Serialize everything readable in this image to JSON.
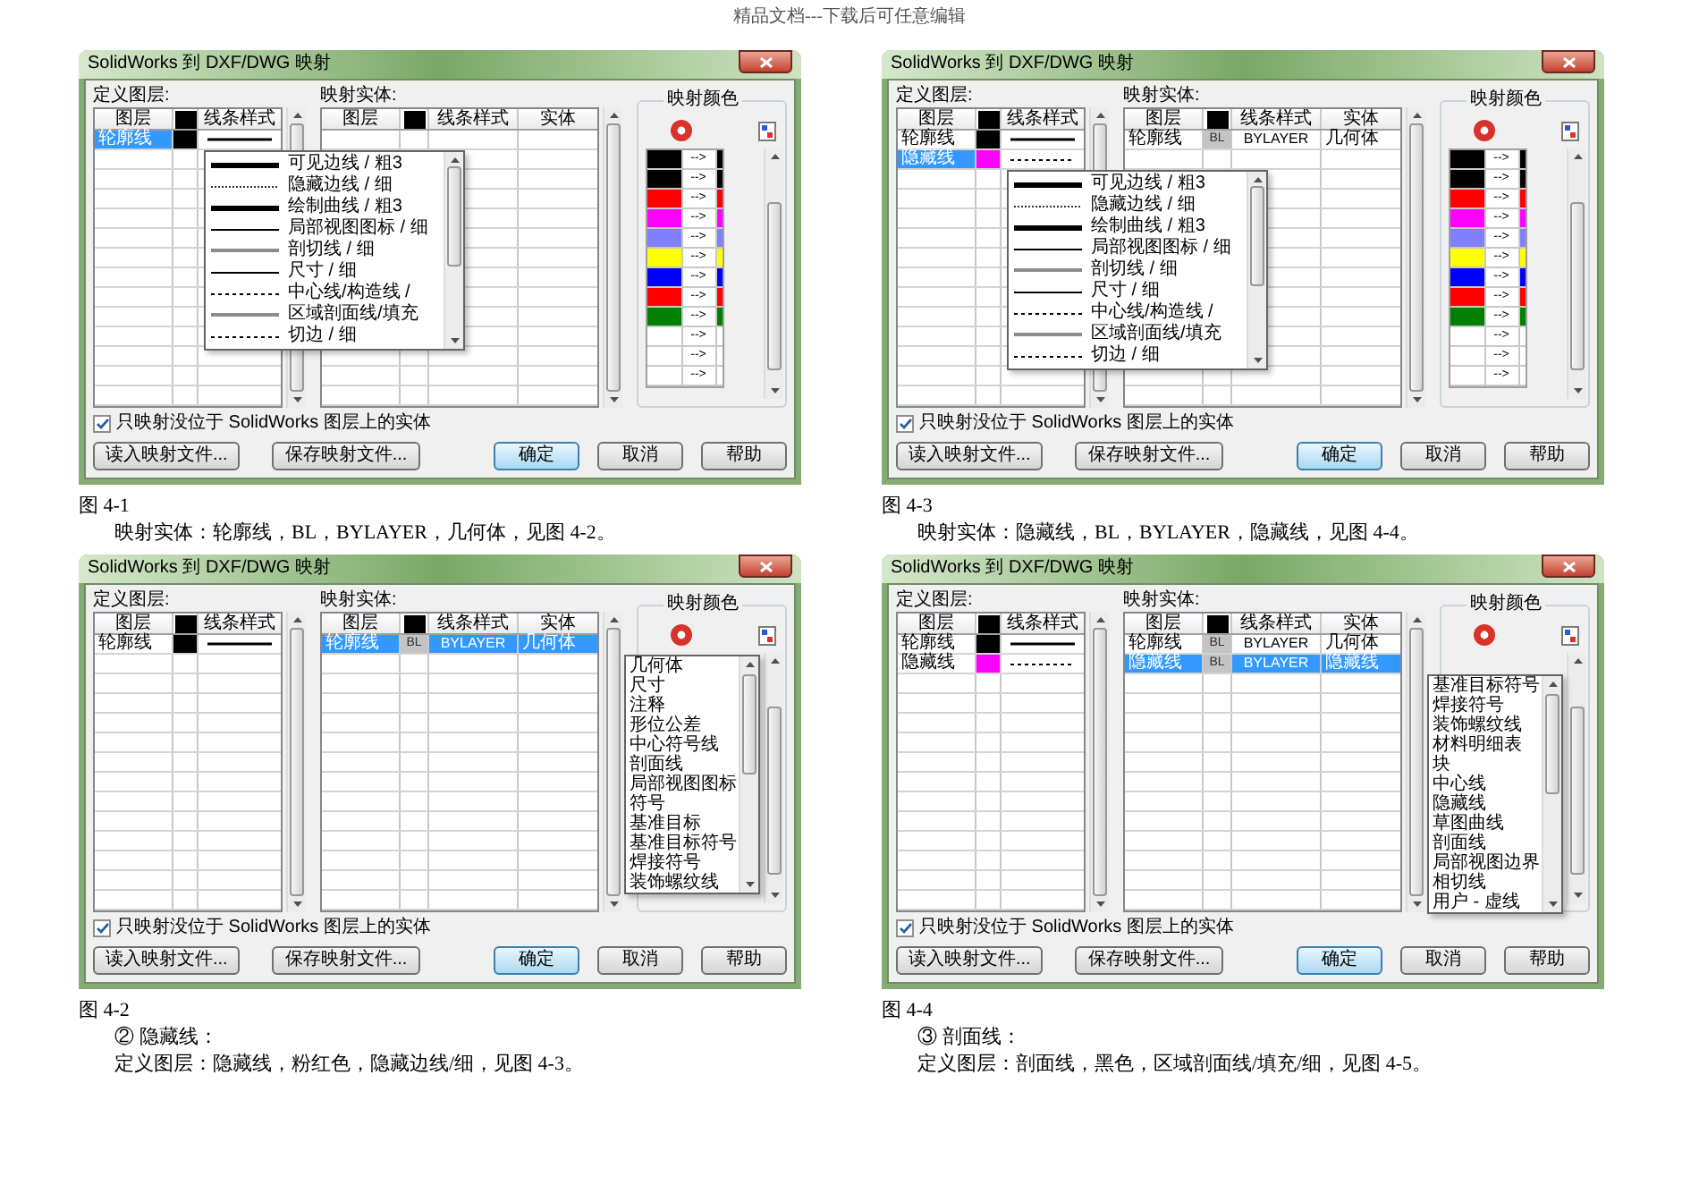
{
  "page_header": "精品文档---下载后可任意编辑",
  "columns": [
    {
      "blocks": [
        {
          "kind": "dialog",
          "title": "SolidWorks 到 DXF/DWG 映射",
          "layers": {
            "label": "定义图层:",
            "columns": [
              "图层",
              "线条样式"
            ],
            "rows": [
              {
                "name": "轮廓线",
                "color": "#000000",
                "kind": "solid",
                "selected": true
              }
            ]
          },
          "entities": {
            "label": "映射实体:",
            "columns": [
              "图层",
              "线条样式",
              "实体"
            ]
          },
          "color_map": {
            "title": "映射颜色",
            "rows": [
              {
                "color": "#000000",
                "arrow": "-->"
              },
              {
                "color": "#000000",
                "arrow": "-->"
              },
              {
                "color": "#ff0000",
                "arrow": "-->"
              },
              {
                "color": "#ff00ff",
                "arrow": "-->"
              },
              {
                "color": "#8080ff",
                "arrow": "-->"
              },
              {
                "color": "#ffff00",
                "arrow": "-->"
              },
              {
                "color": "#0000ff",
                "arrow": "-->"
              },
              {
                "color": "#ff0000",
                "arrow": "-->"
              },
              {
                "color": "#008000",
                "arrow": "-->"
              },
              {
                "color": "#ffffff",
                "arrow": "-->"
              },
              {
                "color": "#ffffff",
                "arrow": "-->"
              },
              {
                "color": "#ffffff",
                "arrow": "-->"
              }
            ]
          },
          "checkbox": {
            "label": "只映射没位于 SolidWorks 图层上的实体",
            "checked": true
          },
          "file_buttons": [
            {
              "label": "读入映射文件...",
              "default": false
            },
            {
              "label": "保存映射文件...",
              "default": false
            }
          ],
          "dialog_buttons": [
            {
              "label": "确定",
              "default": true
            },
            {
              "label": "取消",
              "default": false
            },
            {
              "label": "帮助",
              "default": false
            }
          ],
          "dropdown": {
            "kind": "line_style",
            "items": [
              {
                "label": "可见边线 / 粗3",
                "kind": "thick"
              },
              {
                "label": "隐藏边线 / 细",
                "kind": "dotted"
              },
              {
                "label": "绘制曲线 / 粗3",
                "kind": "thick"
              },
              {
                "label": "局部视图图标 / 细",
                "kind": "thin"
              },
              {
                "label": "剖切线 / 细",
                "kind": "gray"
              },
              {
                "label": "尺寸 / 细",
                "kind": "thin"
              },
              {
                "label": "中心线/构造线 /",
                "kind": "dashed"
              },
              {
                "label": "区域剖面线/填充",
                "kind": "gray"
              },
              {
                "label": "切边 / 细",
                "kind": "dashed"
              }
            ]
          }
        },
        {
          "kind": "caption",
          "text": "图 4-1"
        },
        {
          "kind": "paragraph",
          "text": "映射实体：轮廓线，BL，BYLAYER，几何体，见图 4-2。"
        },
        {
          "kind": "dialog",
          "title": "SolidWorks 到 DXF/DWG 映射",
          "layers": {
            "label": "定义图层:",
            "columns": [
              "图层",
              "线条样式"
            ],
            "rows": [
              {
                "name": "轮廓线",
                "color": "#000000",
                "kind": "solid",
                "selected": false
              }
            ]
          },
          "entities": {
            "label": "映射实体:",
            "columns": [
              "图层",
              "线条样式",
              "实体"
            ],
            "rows": [
              {
                "layer": "轮廓线",
                "code": "BL",
                "line_style": "BYLAYER",
                "entity": "几何体",
                "selected": true
              }
            ]
          },
          "color_map": {
            "title": "映射颜色"
          },
          "checkbox": {
            "label": "只映射没位于 SolidWorks 图层上的实体",
            "checked": true
          },
          "file_buttons": [
            {
              "label": "读入映射文件...",
              "default": false
            },
            {
              "label": "保存映射文件...",
              "default": false
            }
          ],
          "dialog_buttons": [
            {
              "label": "确定",
              "default": true
            },
            {
              "label": "取消",
              "default": false
            },
            {
              "label": "帮助",
              "default": false
            }
          ],
          "dropdown": {
            "kind": "entity",
            "items": [
              {
                "label": "几何体"
              },
              {
                "label": "尺寸"
              },
              {
                "label": "注释"
              },
              {
                "label": "形位公差"
              },
              {
                "label": "中心符号线"
              },
              {
                "label": "剖面线"
              },
              {
                "label": "局部视图图标"
              },
              {
                "label": "符号"
              },
              {
                "label": "基准目标"
              },
              {
                "label": "基准目标符号"
              },
              {
                "label": "焊接符号"
              },
              {
                "label": "装饰螺纹线"
              }
            ]
          }
        },
        {
          "kind": "caption",
          "text": "图 4-2"
        },
        {
          "kind": "paragraph",
          "text": "② 隐藏线："
        },
        {
          "kind": "paragraph",
          "text": "定义图层：隐藏线，粉红色，隐藏边线/细，见图 4-3。"
        }
      ]
    },
    {
      "blocks": [
        {
          "kind": "dialog",
          "title": "SolidWorks 到 DXF/DWG 映射",
          "layers": {
            "label": "定义图层:",
            "columns": [
              "图层",
              "线条样式"
            ],
            "rows": [
              {
                "name": "轮廓线",
                "color": "#000000",
                "kind": "solid",
                "selected": false
              },
              {
                "name": "隐藏线",
                "color": "#ff00ff",
                "kind": "dashed",
                "selected": true
              }
            ]
          },
          "entities": {
            "label": "映射实体:",
            "columns": [
              "图层",
              "线条样式",
              "实体"
            ],
            "rows": [
              {
                "layer": "轮廓线",
                "code": "BL",
                "line_style": "BYLAYER",
                "entity": "几何体",
                "selected": false
              }
            ]
          },
          "color_map": {
            "title": "映射颜色",
            "rows": [
              {
                "color": "#000000",
                "arrow": "-->"
              },
              {
                "color": "#000000",
                "arrow": "-->"
              },
              {
                "color": "#ff0000",
                "arrow": "-->"
              },
              {
                "color": "#ff00ff",
                "arrow": "-->"
              },
              {
                "color": "#8080ff",
                "arrow": "-->"
              },
              {
                "color": "#ffff00",
                "arrow": "-->"
              },
              {
                "color": "#0000ff",
                "arrow": "-->"
              },
              {
                "color": "#ff0000",
                "arrow": "-->"
              },
              {
                "color": "#008000",
                "arrow": "-->"
              },
              {
                "color": "#ffffff",
                "arrow": "-->"
              },
              {
                "color": "#ffffff",
                "arrow": "-->"
              },
              {
                "color": "#ffffff",
                "arrow": "-->"
              }
            ]
          },
          "checkbox": {
            "label": "只映射没位于 SolidWorks 图层上的实体",
            "checked": true
          },
          "file_buttons": [
            {
              "label": "读入映射文件...",
              "default": false
            },
            {
              "label": "保存映射文件...",
              "default": false
            }
          ],
          "dialog_buttons": [
            {
              "label": "确定",
              "default": true
            },
            {
              "label": "取消",
              "default": false
            },
            {
              "label": "帮助",
              "default": false
            }
          ],
          "dropdown": {
            "kind": "line_style",
            "items": [
              {
                "label": "可见边线 / 粗3",
                "kind": "thick"
              },
              {
                "label": "隐藏边线 / 细",
                "kind": "dotted"
              },
              {
                "label": "绘制曲线 / 粗3",
                "kind": "thick"
              },
              {
                "label": "局部视图图标 / 细",
                "kind": "thin"
              },
              {
                "label": "剖切线 / 细",
                "kind": "gray"
              },
              {
                "label": "尺寸 / 细",
                "kind": "thin"
              },
              {
                "label": "中心线/构造线 /",
                "kind": "dashed"
              },
              {
                "label": "区域剖面线/填充",
                "kind": "gray"
              },
              {
                "label": "切边 / 细",
                "kind": "dashed"
              }
            ]
          }
        },
        {
          "kind": "caption",
          "text": "图 4-3"
        },
        {
          "kind": "paragraph",
          "text": "映射实体：隐藏线，BL，BYLAYER，隐藏线，见图 4-4。"
        },
        {
          "kind": "dialog",
          "title": "SolidWorks 到 DXF/DWG 映射",
          "layers": {
            "label": "定义图层:",
            "columns": [
              "图层",
              "线条样式"
            ],
            "rows": [
              {
                "name": "轮廓线",
                "color": "#000000",
                "kind": "solid",
                "selected": false
              },
              {
                "name": "隐藏线",
                "color": "#ff00ff",
                "kind": "dashed",
                "selected": false
              }
            ]
          },
          "entities": {
            "label": "映射实体:",
            "columns": [
              "图层",
              "线条样式",
              "实体"
            ],
            "rows": [
              {
                "layer": "轮廓线",
                "code": "BL",
                "line_style": "BYLAYER",
                "entity": "几何体",
                "selected": false
              },
              {
                "layer": "隐藏线",
                "code": "BL",
                "line_style": "BYLAYER",
                "entity": "隐藏线",
                "selected": true
              }
            ]
          },
          "color_map": {
            "title": "映射颜色"
          },
          "checkbox": {
            "label": "只映射没位于 SolidWorks 图层上的实体",
            "checked": true
          },
          "file_buttons": [
            {
              "label": "读入映射文件...",
              "default": false
            },
            {
              "label": "保存映射文件...",
              "default": false
            }
          ],
          "dialog_buttons": [
            {
              "label": "确定",
              "default": true
            },
            {
              "label": "取消",
              "default": false
            },
            {
              "label": "帮助",
              "default": false
            }
          ],
          "dropdown": {
            "kind": "entity",
            "items": [
              {
                "label": "基准目标符号"
              },
              {
                "label": "焊接符号"
              },
              {
                "label": "装饰螺纹线"
              },
              {
                "label": "材料明细表"
              },
              {
                "label": "块"
              },
              {
                "label": "中心线"
              },
              {
                "label": "隐藏线"
              },
              {
                "label": "草图曲线"
              },
              {
                "label": "剖面线"
              },
              {
                "label": "局部视图边界"
              },
              {
                "label": "相切线"
              },
              {
                "label": "用户 - 虚线"
              }
            ]
          }
        },
        {
          "kind": "caption",
          "text": "图 4-4"
        },
        {
          "kind": "paragraph",
          "text": "③ 剖面线："
        },
        {
          "kind": "paragraph",
          "text": "定义图层：剖面线，黑色，区域剖面线/填充/细，见图 4-5。"
        }
      ]
    }
  ]
}
